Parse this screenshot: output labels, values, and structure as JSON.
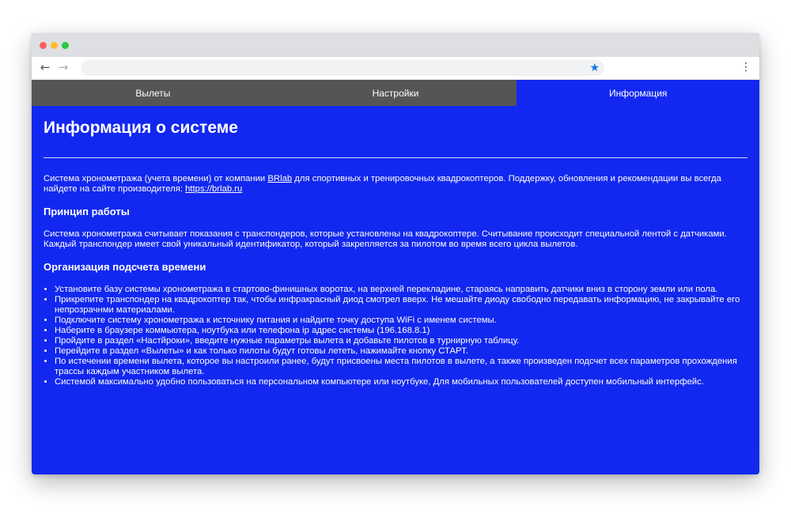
{
  "browser": {
    "url": "",
    "back_icon": "←",
    "forward_icon": "→",
    "star_icon": "★",
    "menu_icon": "⋮"
  },
  "tabs": [
    {
      "label": "Вылеты"
    },
    {
      "label": "Настройки"
    },
    {
      "label": "Информация",
      "active": true
    }
  ],
  "page": {
    "title": "Информация о системе",
    "intro_before_brand": "Система хронометража (учета времени) от компании ",
    "brand_link": "BRlab",
    "intro_after_brand": " для спортивных и тренировочных квадрокоптеров. Поддержку, обновления и рекомендации вы всегда найдете на сайте производителя: ",
    "site_link": "https://brlab.ru",
    "section1_title": "Принцип работы",
    "section1_text": "Система хронометража считывает показания с транспондеров, которые установлены на квадрокоптере. Считывание происходит специальной лентой с датчиками. Каждый транспондер имеет свой уникальный идентификатор, который закрепляется за пилотом во время всего цикла вылетов.",
    "section2_title": "Организация подсчета времени",
    "steps": [
      "Установите базу системы хронометража в стартово-финишных воротах, на верхней перекладине, стараясь направить датчики вниз в сторону земли или пола.",
      "Прикрепите транспондер на квадрокоптер так, чтобы инфракрасный диод смотрел вверх. Не мешайте диоду свободно передавать информацию, не закрывайте его непрозрачнми материалами.",
      "Подключите систему хронометража к источнику питания и найдите точку доступа WiFi с именем системы.",
      "Наберите в браузере коммьютера, ноутбука или телефона ip адрес системы (196.168.8.1)",
      "Пройдите в раздел «Настйроки», введите нужные параметры вылета и добавьте пилотов в турнирную таблицу.",
      "Перейдите в раздел «Вылеты» и как только пилоты будут готовы лететь, нажимайте кнопку СТАРТ.",
      "По истечении времени вылета, которое вы настроили ранее, будут присвоены места пилотов в вылете, а также произведен подсчет всех параметров прохождения трассы каждым участником вылета.",
      "Системой максимально удобно пользоваться на персональном компьютере или ноутбуке, Для мобильных пользователей доступен мобильный интерфейс."
    ]
  },
  "colors": {
    "page_background": "#1228f0",
    "tab_inactive": "#555555",
    "text": "#ffffff"
  }
}
